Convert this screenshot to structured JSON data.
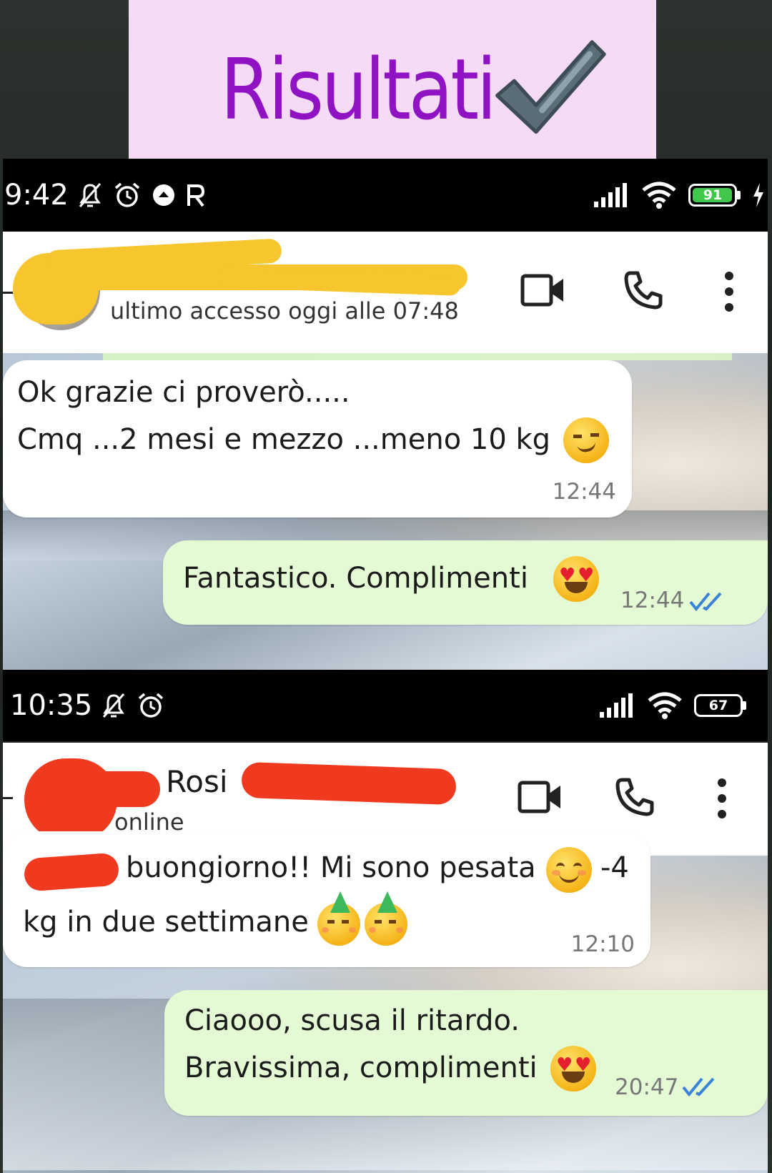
{
  "banner": {
    "title": "Risultati",
    "check_icon": "heavy-check-mark-icon"
  },
  "screenshot1": {
    "status": {
      "time": "9:42",
      "left_icons": [
        "bell-off-icon",
        "alarm-icon",
        "upload-circle-icon",
        "r-icon"
      ],
      "right_icons": [
        "signal-icon",
        "wifi-icon",
        "battery-icon",
        "charging-icon"
      ],
      "battery": "91"
    },
    "header": {
      "subtitle": "ultimo accesso oggi alle 07:48",
      "actions": [
        "video-call-icon",
        "phone-icon",
        "more-vert-icon"
      ]
    },
    "messages": [
      {
        "direction": "incoming",
        "lines": [
          "Ok grazie ci proverò.....",
          "Cmq ...2 mesi e mezzo ...meno 10 kg"
        ],
        "emoji": "smirking-face-icon",
        "time": "12:44"
      },
      {
        "direction": "outgoing",
        "lines": [
          "Fantastico. Complimenti"
        ],
        "emoji": "heart-eyes-icon",
        "time": "12:44",
        "status_icon": "double-check-icon"
      }
    ]
  },
  "screenshot2": {
    "status": {
      "time": "10:35",
      "left_icons": [
        "bell-off-icon",
        "alarm-icon"
      ],
      "right_icons": [
        "signal-icon",
        "wifi-icon",
        "battery-icon"
      ],
      "battery": "67"
    },
    "header": {
      "name": "Rosi",
      "subtitle": "online",
      "actions": [
        "video-call-icon",
        "phone-icon",
        "more-vert-icon"
      ]
    },
    "messages": [
      {
        "direction": "incoming",
        "lines": [
          "buongiorno!! Mi sono pesata",
          "-4",
          "kg in due settimane"
        ],
        "emojis": [
          "smiling-face-icon",
          "partying-face-icon",
          "partying-face-icon"
        ],
        "time": "12:10"
      },
      {
        "direction": "outgoing",
        "lines": [
          "Ciaooo, scusa il ritardo.",
          "Bravissima, complimenti"
        ],
        "emoji": "heart-eyes-icon",
        "time": "20:47",
        "status_icon": "double-check-icon"
      }
    ]
  },
  "colors": {
    "banner_bg": "#f6dbf7",
    "banner_text": "#9013c3",
    "outgoing_bubble": "#e3fad4",
    "incoming_bubble": "#ffffff",
    "read_ticks": "#3b83d6",
    "redaction_yellow": "#f7c52e",
    "redaction_red": "#ef3a1f"
  }
}
